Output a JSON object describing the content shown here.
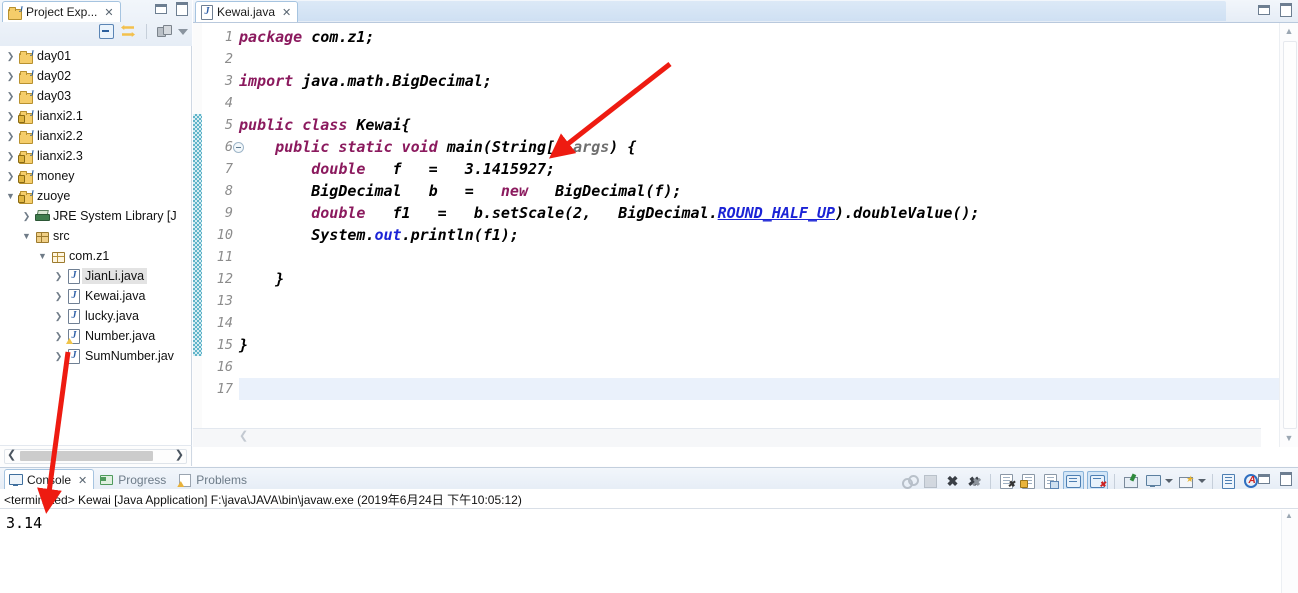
{
  "project_explorer": {
    "title": "Project Exp...",
    "close_label": "✕",
    "toolbar": [
      {
        "name": "collapse-all-icon",
        "label": "collapse-all"
      },
      {
        "name": "link-with-editor-icon",
        "label": "link-with-editor"
      },
      {
        "name": "view-menu-icon",
        "label": "view-menu"
      },
      {
        "name": "view-dropdown-icon",
        "label": "view-dropdown"
      }
    ],
    "tree": [
      {
        "label": "day01",
        "indent": 0,
        "expander": "collapsed",
        "icon": "java-project-icon"
      },
      {
        "label": "day02",
        "indent": 0,
        "expander": "collapsed",
        "icon": "java-project-icon"
      },
      {
        "label": "day03",
        "indent": 0,
        "expander": "collapsed",
        "icon": "java-project-icon"
      },
      {
        "label": "lianxi2.1",
        "indent": 0,
        "expander": "collapsed",
        "icon": "java-project-locked-icon"
      },
      {
        "label": "lianxi2.2",
        "indent": 0,
        "expander": "collapsed",
        "icon": "java-project-icon"
      },
      {
        "label": "lianxi2.3",
        "indent": 0,
        "expander": "collapsed",
        "icon": "java-project-locked-icon"
      },
      {
        "label": "money",
        "indent": 0,
        "expander": "collapsed",
        "icon": "java-project-locked-icon"
      },
      {
        "label": "zuoye",
        "indent": 0,
        "expander": "expanded",
        "icon": "java-project-locked-icon"
      },
      {
        "label": "JRE System Library [J",
        "indent": 1,
        "expander": "collapsed",
        "icon": "jre-library-icon"
      },
      {
        "label": "src",
        "indent": 1,
        "expander": "expanded",
        "icon": "source-folder-icon"
      },
      {
        "label": "com.z1",
        "indent": 2,
        "expander": "expanded",
        "icon": "package-icon"
      },
      {
        "label": "JianLi.java",
        "indent": 3,
        "expander": "collapsed",
        "icon": "java-file-icon",
        "selected": true
      },
      {
        "label": "Kewai.java",
        "indent": 3,
        "expander": "collapsed",
        "icon": "java-file-icon"
      },
      {
        "label": "lucky.java",
        "indent": 3,
        "expander": "collapsed",
        "icon": "java-file-icon"
      },
      {
        "label": "Number.java",
        "indent": 3,
        "expander": "collapsed",
        "icon": "java-file-warning-icon"
      },
      {
        "label": "SumNumber.jav",
        "indent": 3,
        "expander": "collapsed",
        "icon": "java-file-icon"
      }
    ]
  },
  "editor": {
    "tab": {
      "label": "Kewai.java",
      "close_label": "✕",
      "icon": "java-file-icon"
    },
    "current_line": 17,
    "changed_bar_from": 5,
    "changed_bar_to": 15,
    "fold_marker_line": 6,
    "lines": [
      {
        "n": 1,
        "tokens": [
          {
            "t": "package ",
            "c": "k"
          },
          {
            "t": "com.z1;",
            "c": "id"
          }
        ]
      },
      {
        "n": 2,
        "tokens": []
      },
      {
        "n": 3,
        "tokens": [
          {
            "t": "import ",
            "c": "k"
          },
          {
            "t": "java.math.BigDecimal;",
            "c": "id"
          }
        ]
      },
      {
        "n": 4,
        "tokens": []
      },
      {
        "n": 5,
        "tokens": [
          {
            "t": "public class ",
            "c": "k"
          },
          {
            "t": "Kewai{",
            "c": "id"
          }
        ]
      },
      {
        "n": 6,
        "tokens": [
          {
            "t": "    ",
            "c": "id"
          },
          {
            "t": "public static void ",
            "c": "k"
          },
          {
            "t": "main(String[] ",
            "c": "id"
          },
          {
            "t": "args",
            "c": "par"
          },
          {
            "t": ") {",
            "c": "id"
          }
        ]
      },
      {
        "n": 7,
        "tokens": [
          {
            "t": "        ",
            "c": "id"
          },
          {
            "t": "double",
            "c": "k"
          },
          {
            "t": "   f   =   3.1415927;",
            "c": "id"
          }
        ]
      },
      {
        "n": 8,
        "tokens": [
          {
            "t": "        BigDecimal   b   =   ",
            "c": "id"
          },
          {
            "t": "new",
            "c": "k"
          },
          {
            "t": "   BigDecimal(f);",
            "c": "id"
          }
        ]
      },
      {
        "n": 9,
        "tokens": [
          {
            "t": "        ",
            "c": "id"
          },
          {
            "t": "double",
            "c": "k"
          },
          {
            "t": "   f1   =   b.setScale(2,   BigDecimal.",
            "c": "id"
          },
          {
            "t": "ROUND_HALF_UP",
            "c": "sf"
          },
          {
            "t": ").doubleValue();",
            "c": "id"
          }
        ]
      },
      {
        "n": 10,
        "tokens": [
          {
            "t": "        System.",
            "c": "id"
          },
          {
            "t": "out",
            "c": "sfi"
          },
          {
            "t": ".println(f1);",
            "c": "id"
          }
        ]
      },
      {
        "n": 11,
        "tokens": []
      },
      {
        "n": 12,
        "tokens": [
          {
            "t": "    }",
            "c": "id"
          }
        ]
      },
      {
        "n": 13,
        "tokens": []
      },
      {
        "n": 14,
        "tokens": []
      },
      {
        "n": 15,
        "tokens": [
          {
            "t": "}",
            "c": "id"
          }
        ]
      },
      {
        "n": 16,
        "tokens": []
      },
      {
        "n": 17,
        "tokens": []
      }
    ]
  },
  "console": {
    "tabs": [
      {
        "label": "Console",
        "active": true,
        "icon": "console-icon",
        "close_label": "✕"
      },
      {
        "label": "Progress",
        "active": false,
        "icon": "progress-icon"
      },
      {
        "label": "Problems",
        "active": false,
        "icon": "problems-icon"
      }
    ],
    "info_line": "<terminated> Kewai [Java Application] F:\\java\\JAVA\\bin\\javaw.exe (2019年6月24日 下午10:05:12)",
    "output": "3.14",
    "toolbar": [
      {
        "name": "terminate-all-icon",
        "state": "disabled"
      },
      {
        "name": "remove-launch-icon",
        "state": "disabled"
      },
      {
        "name": "remove-all-terminated-icon",
        "state": "enabled"
      },
      {
        "name": "remove-all-icon",
        "state": "enabled"
      },
      {
        "name": "clear-console-icon",
        "state": "enabled"
      },
      {
        "name": "scroll-lock-icon",
        "state": "enabled"
      },
      {
        "name": "word-wrap-icon",
        "state": "enabled"
      },
      {
        "name": "show-console-on-output-icon",
        "state": "toggled"
      },
      {
        "name": "show-console-on-error-icon",
        "state": "toggled"
      },
      {
        "name": "pin-console-icon",
        "state": "enabled"
      },
      {
        "name": "display-selected-console-icon",
        "state": "enabled"
      },
      {
        "name": "display-selected-console-dropdown",
        "state": "enabled"
      },
      {
        "name": "open-console-icon",
        "state": "enabled"
      },
      {
        "name": "open-console-dropdown",
        "state": "enabled"
      },
      {
        "name": "new-console-view-icon",
        "state": "enabled"
      },
      {
        "name": "aspectj-console-icon",
        "state": "enabled"
      }
    ]
  },
  "window_controls": {
    "minimize_label": "minimize",
    "maximize_label": "maximize"
  },
  "annotations": {
    "arrow_color": "#ee1b11",
    "arrow_to_code_label": "arrow-pointing-to-main-string-arg",
    "arrow_to_console_label": "arrow-pointing-to-terminated-console"
  }
}
